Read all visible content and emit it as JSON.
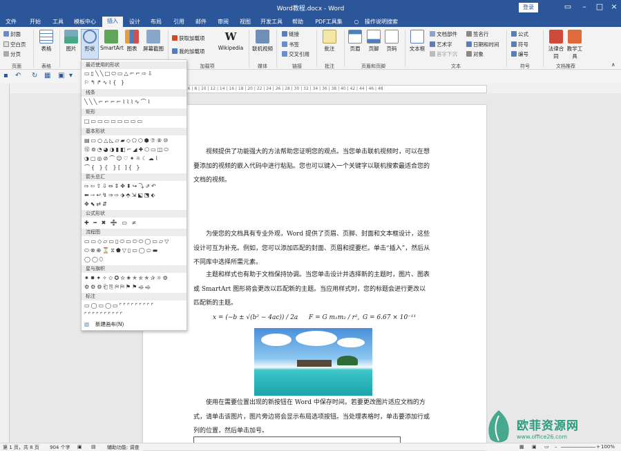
{
  "window": {
    "title": "Word教程.docx - Word",
    "login_label": "登录",
    "minimize_icon": "–",
    "restore_icon": "□",
    "close_icon": "×"
  },
  "tabs": [
    "文件",
    "开始",
    "工具",
    "模板中心",
    "插入",
    "设计",
    "布局",
    "引用",
    "邮件",
    "审阅",
    "视图",
    "开发工具",
    "帮助",
    "PDF工具集",
    "操作说明搜索"
  ],
  "active_tab": "插入",
  "ribbon": {
    "pages": {
      "cover": "封面",
      "blank": "空白页",
      "break": "分页",
      "label": "页面"
    },
    "tables": {
      "table": "表格",
      "label": "表格"
    },
    "illustrations": {
      "pictures": "图片",
      "shapes": "形状",
      "smartart": "SmartArt",
      "chart": "图表",
      "screenshot": "屏幕截图"
    },
    "addins": {
      "get": "获取加载项",
      "my": "我的加载项",
      "wikipedia": "Wikipedia",
      "label": "加载项"
    },
    "media": {
      "video": "联机视频",
      "label": "媒体"
    },
    "links": {
      "link": "链接",
      "bookmark": "书签",
      "crossref": "交叉引用",
      "label": "链接"
    },
    "comments": {
      "comment": "批注",
      "label": "批注"
    },
    "header_footer": {
      "header": "页眉",
      "footer": "页脚",
      "page_number": "页码",
      "label": "页眉和页脚"
    },
    "text": {
      "textbox": "文本框",
      "quickparts": "文档部件",
      "wordart": "艺术字",
      "dropcap": "首字下沉",
      "signature": "签名行",
      "datetime": "日期和时间",
      "object": "对象",
      "label": "文本"
    },
    "symbols": {
      "equation": "公式",
      "symbol": "符号",
      "number": "编号",
      "label": "符号"
    },
    "recommend": {
      "law": "法律合同",
      "edu": "教学工具",
      "label": "文档推荐"
    }
  },
  "shapes_dropdown": {
    "sections": [
      {
        "title": "最近使用的形状",
        "rows": [
          "▭▯╲╲□⬭▭△⌐⌐⇨⇩",
          "⚐↰↱∿⌇{ }"
        ]
      },
      {
        "title": "线条",
        "rows": [
          "╲╲╲⌐⌐⌐⌐⌇⌇⌇∿⌒⌇"
        ]
      },
      {
        "title": "矩形",
        "rows": [
          "□▭▭▭▭▭▭▭▭"
        ]
      },
      {
        "title": "基本形状",
        "rows": [
          "▤▭○△◺▱▰◇⬠⬡⬢⑦⑧⑩",
          "⑫⊚◔◕◑▮◧⌐◢✚⬡▭◫⬭",
          "◑▢◎⊘⌒☺♡✦☼☾☁⌇",
          "⌒{ }⦃ ⦄[ ]{ }"
        ]
      },
      {
        "title": "箭头总汇",
        "rows": [
          "⇨⇦⇧⇩⇔⇕✥⬍↪⤵⇗↶",
          "⬅⇾↩↯⇒⇨⬗⬘⇲⬕⬔⬖",
          "✥⬉⇄⇵"
        ]
      },
      {
        "title": "公式形状",
        "rows": [
          "✚ ━ ✖ ➗ ▭ ≠"
        ]
      },
      {
        "title": "流程图",
        "rows": [
          "▭▭◇▱▭▯⬭▭⬭⬭◯▭▱▽",
          "⬭⊗⊕⌛⧖⬟▽▯▭◯⬭▬",
          "◯◯⬯"
        ]
      },
      {
        "title": "星与旗帜",
        "rows": [
          "✷✸✦✧✩✪✫✬✭✮✯✰☼⚙",
          "⚙⚙⚙⎗⎘⛿⛿⚑⚑⬲⬲"
        ]
      },
      {
        "title": "标注",
        "rows": [
          "▭◯▭◯▭⌜⌜⌜⌜⌜⌜⌜⌜⌜",
          "⌜⌜⌜⌜⌜⌜⌜⌜⌜⌜"
        ]
      }
    ],
    "footer": "新建画布(N)"
  },
  "document": {
    "p1": "视频提供了功能强大的方法帮助您证明您的观点。当您单击联机视频时，可以在想要添加的视频的嵌入代码中进行粘贴。您也可以键入一个关键字以联机搜索最适合您的文档的视频。",
    "p2": "为使您的文档具有专业外观，Word 提供了页眉、页脚、封面和文本框设计，这些设计可互为补充。例如，您可以添加匹配的封面、页眉和提要栏。单击“插入”，然后从不同库中选择所需元素。",
    "p3": "主题和样式也有助于文档保持协调。当您单击设计并选择新的主题时，图片、图表或 SmartArt 图形将会更改以匹配新的主题。当应用样式时，您的标题会进行更改以匹配新的主题。",
    "formula_quadratic": "x = (−b ± √(b² − 4ac)) / 2a",
    "formula_gravity": "F = G m₁m₂ / r²,",
    "formula_constant": "G = 6.67 × 10⁻¹¹",
    "p4": "使用在需要位置出现的新按钮在 Word 中保存时间。若要更改图片适应文档的方式，请单击该图片，图片旁边将会显示布局选项按钮。当处理表格时，单击要添加行或列的位置，然后单击加号。"
  },
  "status": {
    "page": "第 1 页，共 8 页",
    "words": "904 个字",
    "accessibility": "辅助功能: 调查",
    "zoom": "100%"
  },
  "watermark": {
    "text": "欧菲资源网",
    "url": "www.office26.com"
  },
  "colors": {
    "accent": "#2b579a",
    "watermark": "#2a9c7c"
  }
}
